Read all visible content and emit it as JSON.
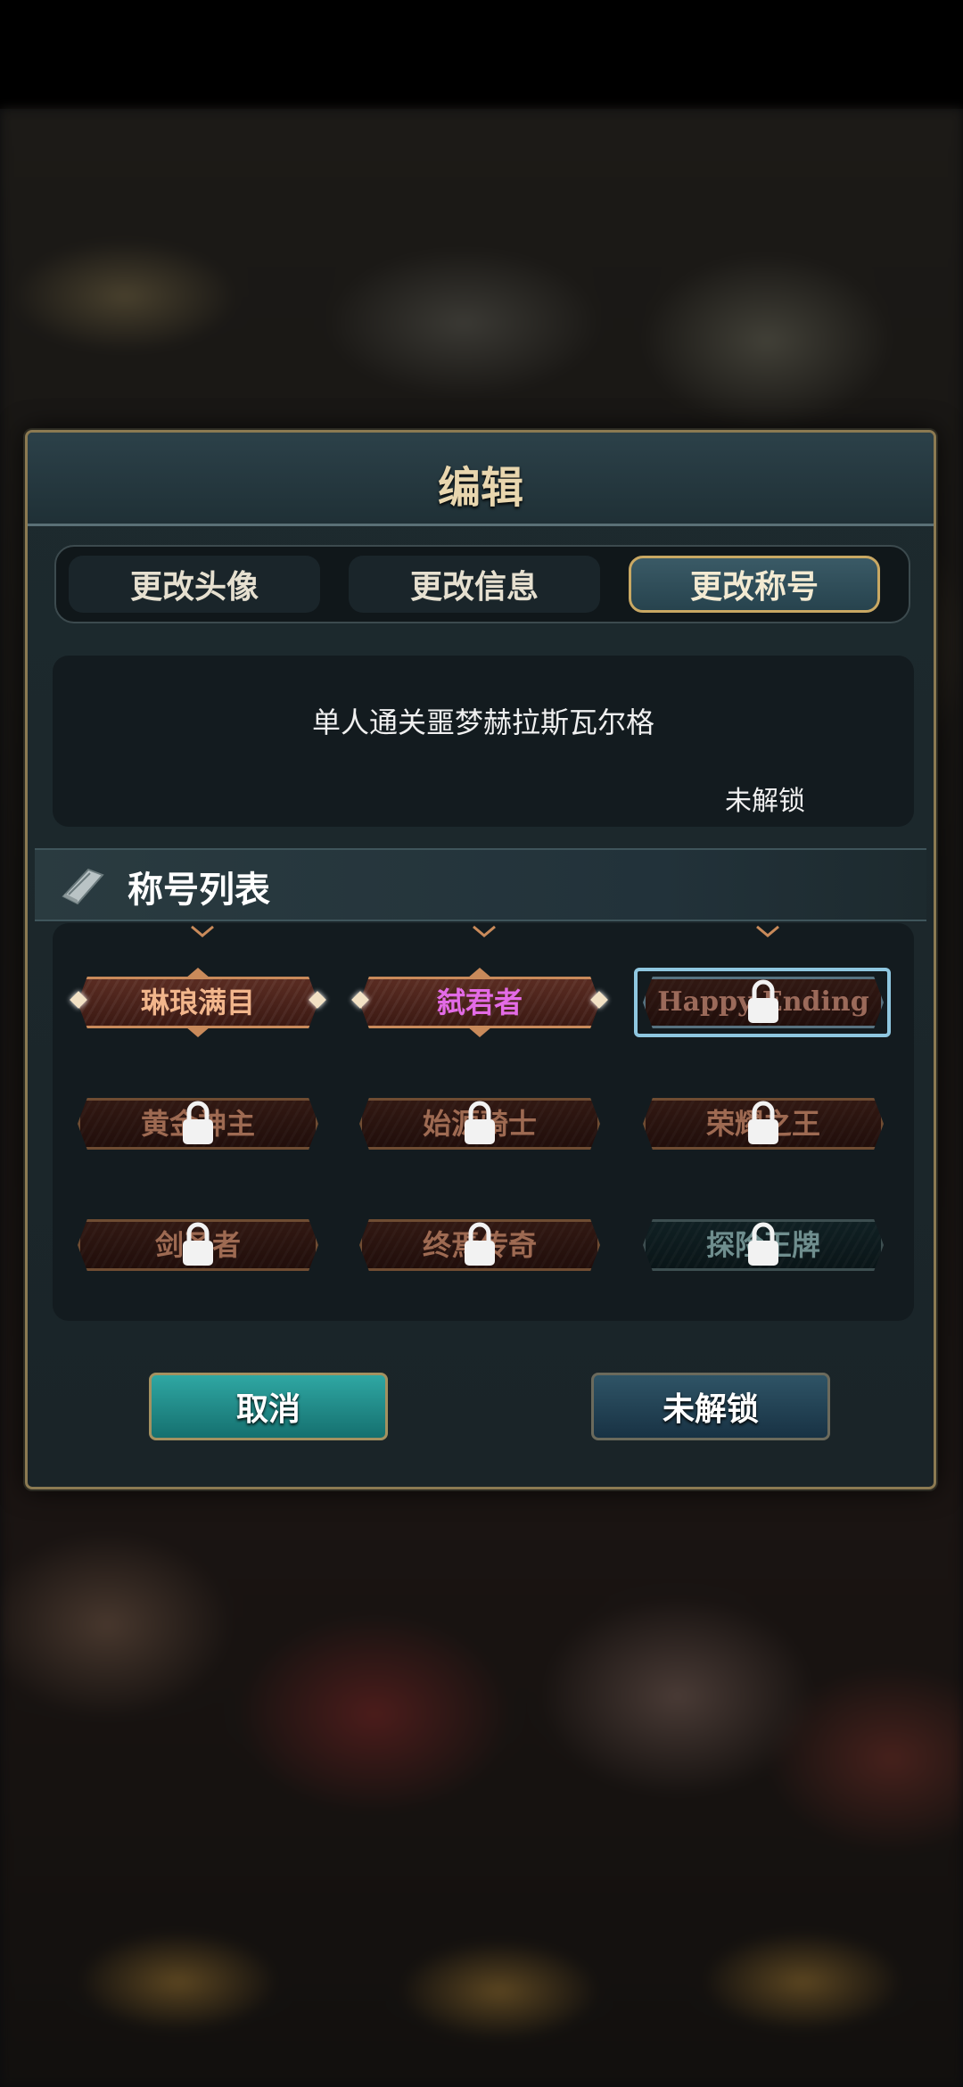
{
  "dialog": {
    "title": "编辑"
  },
  "tabs": [
    {
      "label": "更改头像",
      "active": false
    },
    {
      "label": "更改信息",
      "active": false
    },
    {
      "label": "更改称号",
      "active": true
    }
  ],
  "info": {
    "condition": "单人通关噩梦赫拉斯瓦尔格",
    "status": "未解锁"
  },
  "section": {
    "title": "称号列表",
    "icon": "book-icon"
  },
  "titles": [
    {
      "name": "琳琅满目",
      "locked": false,
      "selected": false
    },
    {
      "name": "弑君者",
      "locked": false,
      "selected": false
    },
    {
      "name": "Happy Ending",
      "locked": true,
      "selected": true
    },
    {
      "name": "黄金神主",
      "locked": true,
      "selected": false
    },
    {
      "name": "始源骑士",
      "locked": true,
      "selected": false
    },
    {
      "name": "荣耀之王",
      "locked": true,
      "selected": false
    },
    {
      "name": "剑圣者",
      "locked": true,
      "selected": false
    },
    {
      "name": "终焉传奇",
      "locked": true,
      "selected": false
    },
    {
      "name": "探险王牌",
      "locked": true,
      "selected": false
    }
  ],
  "buttons": {
    "cancel": "取消",
    "confirm": "未解锁"
  },
  "colors": {
    "gold_border": "#8c7a52",
    "cancel_teal": "#2fa7a3",
    "selected_outline": "#8fc7e0",
    "pink_title": "#e36be6"
  }
}
